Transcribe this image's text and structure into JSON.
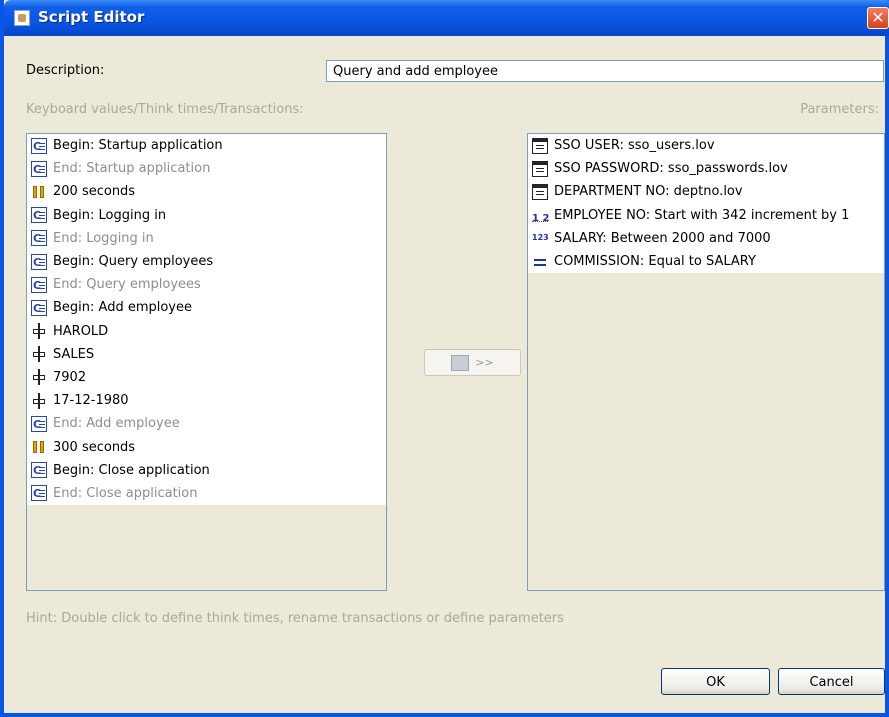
{
  "window": {
    "title": "Script Editor",
    "close_glyph": "✕"
  },
  "description": {
    "label": "Description:",
    "value": "Query and add employee"
  },
  "left_panel": {
    "label": "Keyboard values/Think times/Transactions:",
    "items": [
      {
        "icon": "transaction-icon",
        "text": "Begin: Startup application",
        "muted": false
      },
      {
        "icon": "transaction-icon",
        "text": "End: Startup application",
        "muted": true
      },
      {
        "icon": "think-time-icon",
        "text": "200 seconds",
        "muted": false
      },
      {
        "icon": "transaction-icon",
        "text": "Begin: Logging in",
        "muted": false
      },
      {
        "icon": "transaction-icon",
        "text": "End: Logging in",
        "muted": true
      },
      {
        "icon": "transaction-icon",
        "text": "Begin: Query employees",
        "muted": false
      },
      {
        "icon": "transaction-icon",
        "text": "End: Query employees",
        "muted": true
      },
      {
        "icon": "transaction-icon",
        "text": "Begin: Add employee",
        "muted": false
      },
      {
        "icon": "keyboard-value-icon",
        "text": "HAROLD",
        "muted": false
      },
      {
        "icon": "keyboard-value-icon",
        "text": "SALES",
        "muted": false
      },
      {
        "icon": "keyboard-value-icon",
        "text": "7902",
        "muted": false
      },
      {
        "icon": "keyboard-value-icon",
        "text": "17-12-1980",
        "muted": false
      },
      {
        "icon": "transaction-icon",
        "text": "End: Add employee",
        "muted": true
      },
      {
        "icon": "think-time-icon",
        "text": "300 seconds",
        "muted": false
      },
      {
        "icon": "transaction-icon",
        "text": "Begin: Close application",
        "muted": false
      },
      {
        "icon": "transaction-icon",
        "text": "End: Close application",
        "muted": true
      }
    ]
  },
  "right_panel": {
    "label": "Parameters:",
    "items": [
      {
        "icon": "list-of-values-icon",
        "icon_text": "",
        "text": "SSO USER: sso_users.lov"
      },
      {
        "icon": "list-of-values-icon",
        "icon_text": "",
        "text": "SSO PASSWORD: sso_passwords.lov"
      },
      {
        "icon": "list-of-values-icon",
        "icon_text": "",
        "text": "DEPARTMENT NO: deptno.lov"
      },
      {
        "icon": "sequence-icon",
        "icon_text": "1 2",
        "text": "EMPLOYEE NO: Start with 342 increment by 1"
      },
      {
        "icon": "random-number-icon",
        "icon_text": "123",
        "text": "SALARY: Between 2000 and 7000"
      },
      {
        "icon": "equal-to-icon",
        "icon_text": "",
        "text": "COMMISSION: Equal to SALARY"
      }
    ]
  },
  "move_button": {
    "label": ">>"
  },
  "hint": "Hint: Double click to define think times, rename transactions or define parameters",
  "buttons": {
    "ok": "OK",
    "cancel": "Cancel"
  }
}
